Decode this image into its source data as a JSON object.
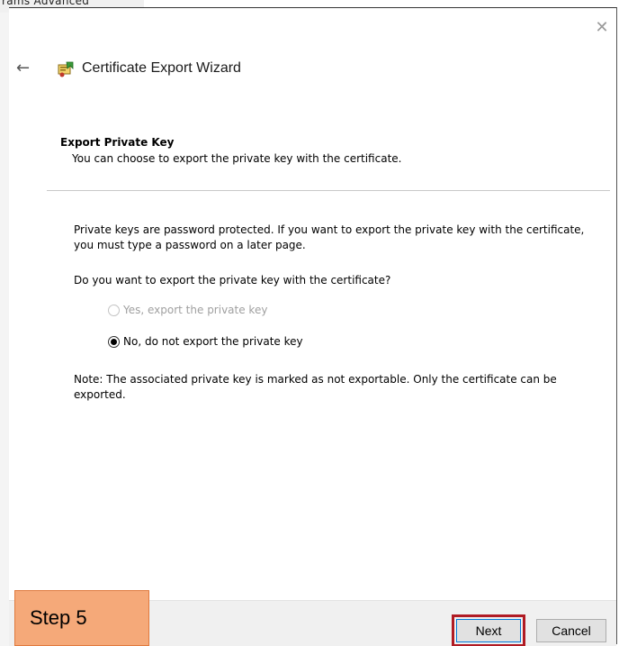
{
  "background_window": {
    "tabs_text": "rams Advanced"
  },
  "dialog": {
    "close_glyph": "✕",
    "back_glyph": "←",
    "title": "Certificate Export Wizard",
    "icon": "certificate-wizard-icon"
  },
  "page": {
    "heading": "Export Private Key",
    "subheading": "You can choose to export the private key with the certificate.",
    "info_text": "Private keys are password protected. If you want to export the private key with the certificate, you must type a password on a later page.",
    "question": "Do you want to export the private key with the certificate?",
    "options": [
      {
        "label": "Yes, export the private key",
        "selected": false,
        "enabled": false
      },
      {
        "label": "No, do not export the private key",
        "selected": true,
        "enabled": true
      }
    ],
    "note": "Note: The associated private key is marked as not exportable. Only the certificate can be exported."
  },
  "footer": {
    "next_label": "Next",
    "cancel_label": "Cancel"
  },
  "annotation": {
    "step_label": "Step 5",
    "highlight_color": "#b01b24",
    "callout_color": "#f5a979"
  }
}
